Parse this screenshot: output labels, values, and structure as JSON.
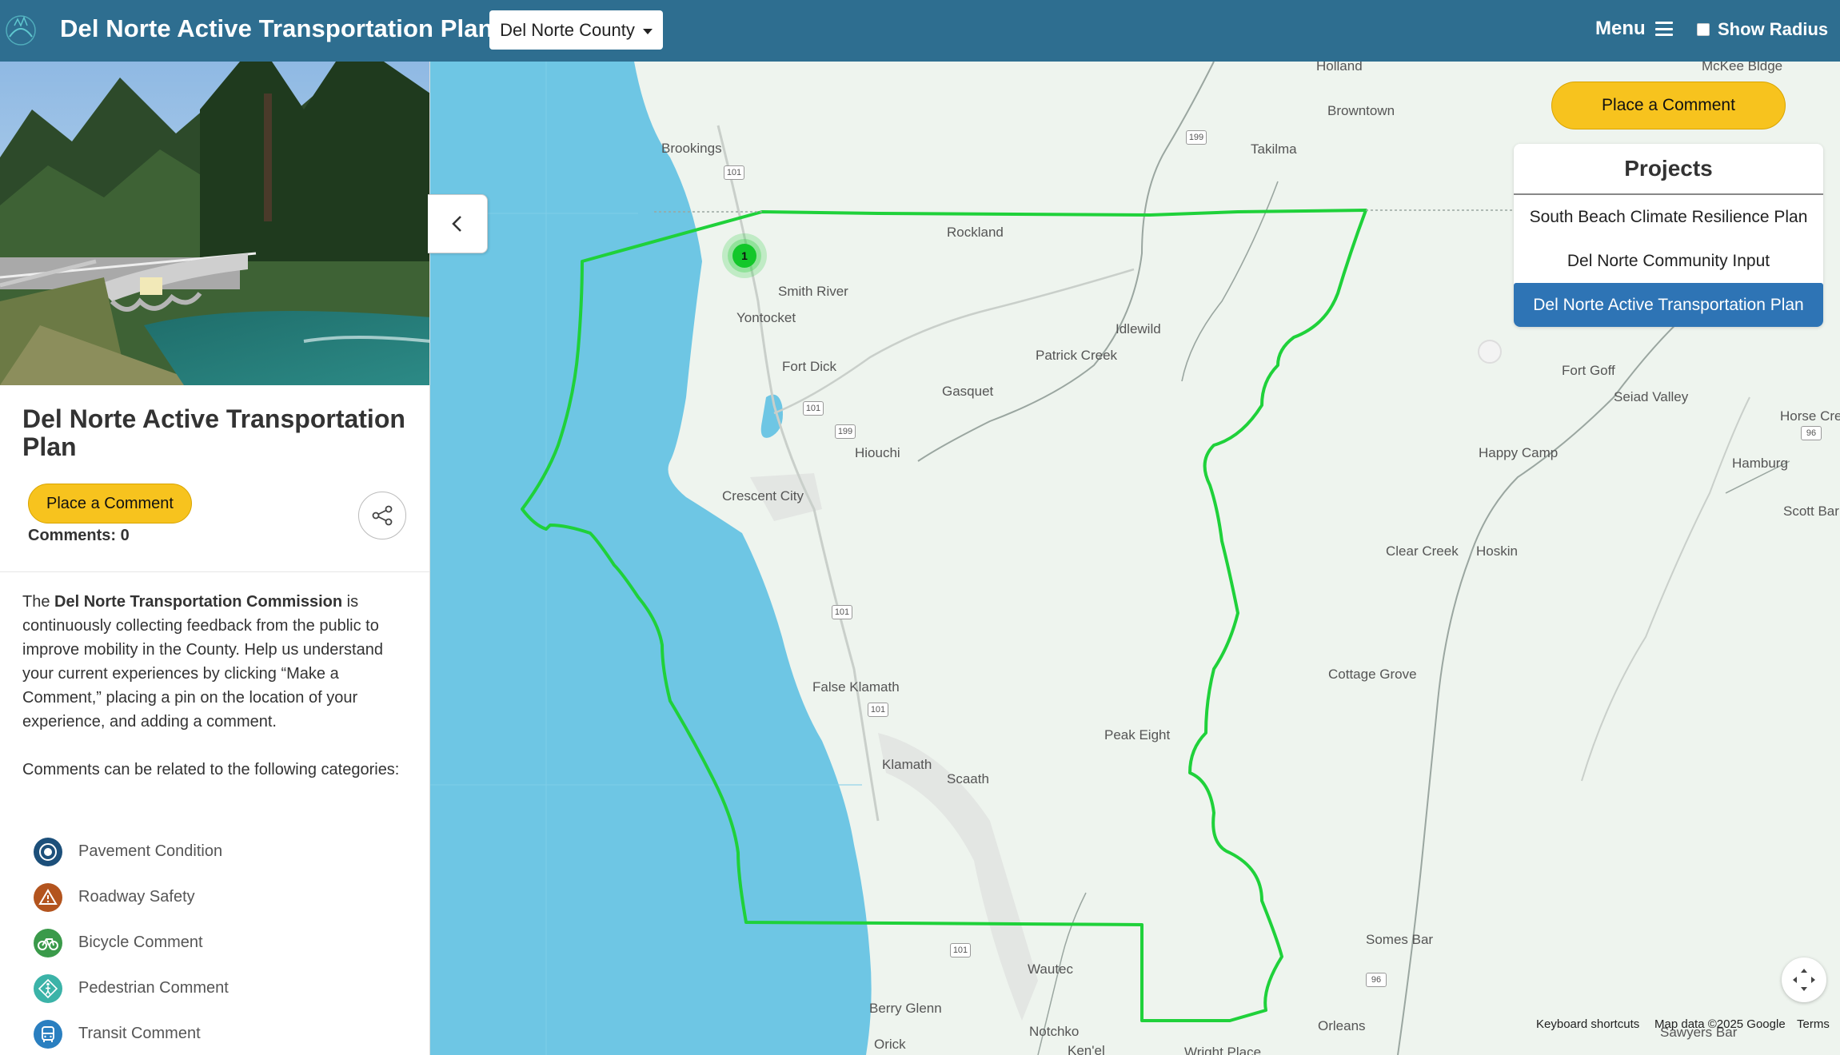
{
  "header": {
    "title": "Del Norte Active Transportation Plan",
    "county_dropdown": "Del Norte County",
    "menu_label": "Menu",
    "show_radius_label": "Show Radius"
  },
  "sidebar": {
    "title": "Del Norte Active Transportation Plan",
    "comment_button": "Place a Comment",
    "comments_count": "Comments: 0",
    "desc_intro": "The ",
    "desc_bold": "Del Norte Transportation Commission",
    "desc_rest": " is continuously collecting feedback from the public to improve mobility in the County. Help us understand your current experiences by clicking “Make a Comment,” placing a pin on the location of your experience, and adding a comment.",
    "categories_intro": "Comments can be related to the following categories:",
    "categories": [
      {
        "label": "Pavement Condition",
        "icon": "pavement-icon",
        "color": "#1c4f7a"
      },
      {
        "label": "Roadway Safety",
        "icon": "warning-icon",
        "color": "#b3541e"
      },
      {
        "label": "Bicycle Comment",
        "icon": "bicycle-icon",
        "color": "#3a9a4a"
      },
      {
        "label": "Pedestrian Comment",
        "icon": "pedestrian-icon",
        "color": "#3bb3a8"
      },
      {
        "label": "Transit Comment",
        "icon": "bus-icon",
        "color": "#2a7fc0"
      }
    ]
  },
  "map": {
    "comment_button": "Place a Comment",
    "projects_title": "Projects",
    "projects": [
      {
        "label": "South Beach Climate Resilience Plan",
        "active": false
      },
      {
        "label": "Del Norte Community Input",
        "active": false
      },
      {
        "label": "Del Norte Active Transportation Plan",
        "active": true
      }
    ],
    "cluster_count": "1",
    "places": [
      "Holland",
      "McKee Bldge",
      "Browntown",
      "Takilma",
      "Brookings",
      "Rockland",
      "Smith River",
      "Yontocket",
      "Idlewild",
      "Patrick Creek",
      "Fort Dick",
      "Gasquet",
      "Hiouchi",
      "Crescent City",
      "Fort Goff",
      "Seiad Valley",
      "Horse Cre",
      "Happy Camp",
      "Hamburg",
      "Scott Bar",
      "Clear Creek",
      "Hoskin",
      "Cottage Grove",
      "False Klamath",
      "Peak Eight",
      "Klamath",
      "Scaath",
      "Somes Bar",
      "Wautec",
      "Berry Glenn",
      "Notchko",
      "Orleans",
      "Orick",
      "Ken'el",
      "Wright Place",
      "Sawyers Bar"
    ],
    "routes": [
      "101",
      "199",
      "101",
      "199",
      "101",
      "101",
      "101",
      "96",
      "96"
    ],
    "attribution": {
      "shortcuts": "Keyboard shortcuts",
      "map_data": "Map data ©2025 Google",
      "terms": "Terms"
    },
    "colors": {
      "ocean": "#6ec6e4",
      "land": "#eef4ee",
      "boundary": "#1fd13a",
      "navbar": "#2e6e90",
      "accent_button": "#f7c31e",
      "active_project": "#2e74b5"
    }
  }
}
